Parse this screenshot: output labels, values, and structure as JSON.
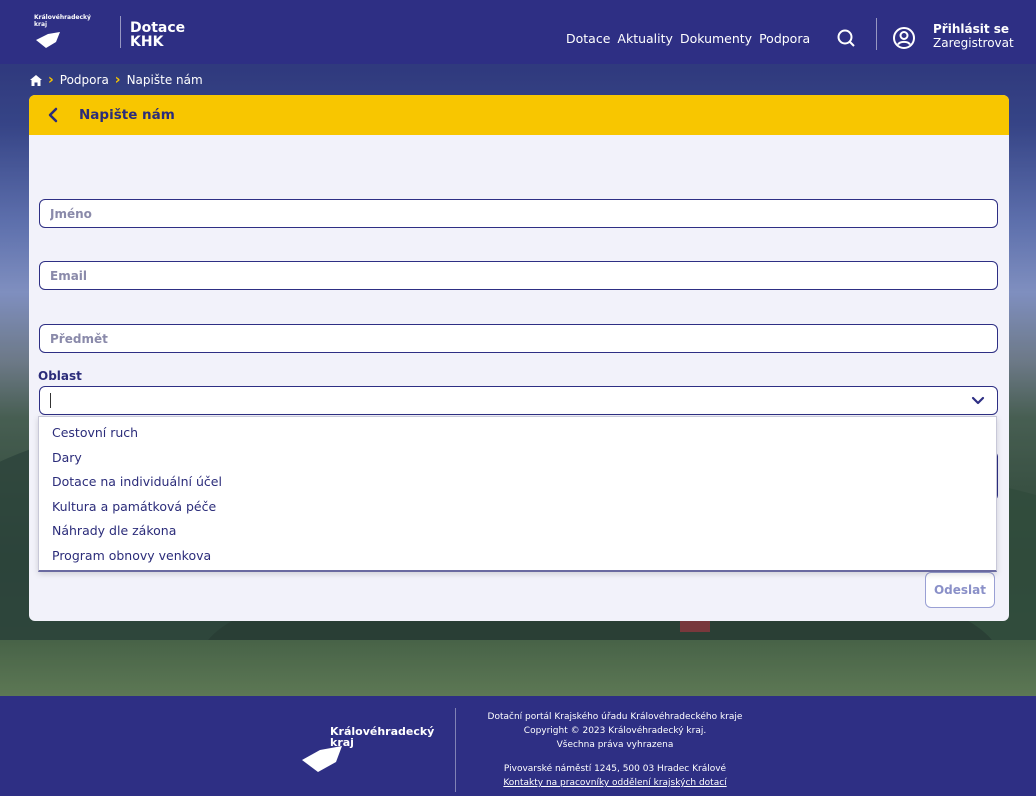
{
  "header": {
    "logo_text_line1": "Královéhradecký",
    "logo_text_line2": "kraj",
    "brand_line1": "Dotace",
    "brand_line2": "KHK",
    "nav": [
      "Dotace",
      "Aktuality",
      "Dokumenty",
      "Podpora"
    ],
    "login_label": "Přihlásit se",
    "register_label": "Zaregistrovat"
  },
  "breadcrumb": {
    "items": [
      "Podpora",
      "Napište nám"
    ]
  },
  "card": {
    "title": "Napište nám",
    "fields": {
      "name_placeholder": "Jméno",
      "email_placeholder": "Email",
      "subject_placeholder": "Předmět"
    },
    "oblast_label": "Oblast",
    "oblast_value": "",
    "dropdown_options": [
      "Cestovní ruch",
      "Dary",
      "Dotace na individuální účel",
      "Kultura a památková péče",
      "Náhrady dle zákona",
      "Program obnovy venkova"
    ],
    "submit_label": "Odeslat"
  },
  "footer": {
    "logo_line1": "Královéhradecký",
    "logo_line2": "kraj",
    "line1": "Dotační portál Krajského úřadu Královéhradeckého kraje",
    "line2": "Copyright © 2023 Královéhradecký kraj.",
    "line3": "Všechna práva vyhrazena",
    "address": "Pivovarské náměstí 1245, 500 03 Hradec Králové",
    "contacts_link": "Kontakty na pracovníky oddělení krajských dotací"
  },
  "colors": {
    "primary": "#2e2f84",
    "accent": "#f8c600",
    "card_bg": "#f2f2fa"
  },
  "icons": {
    "home": "home-icon",
    "search": "search-icon",
    "user": "user-icon",
    "back": "chevron-left-icon",
    "dropdown": "chevron-down-icon"
  }
}
